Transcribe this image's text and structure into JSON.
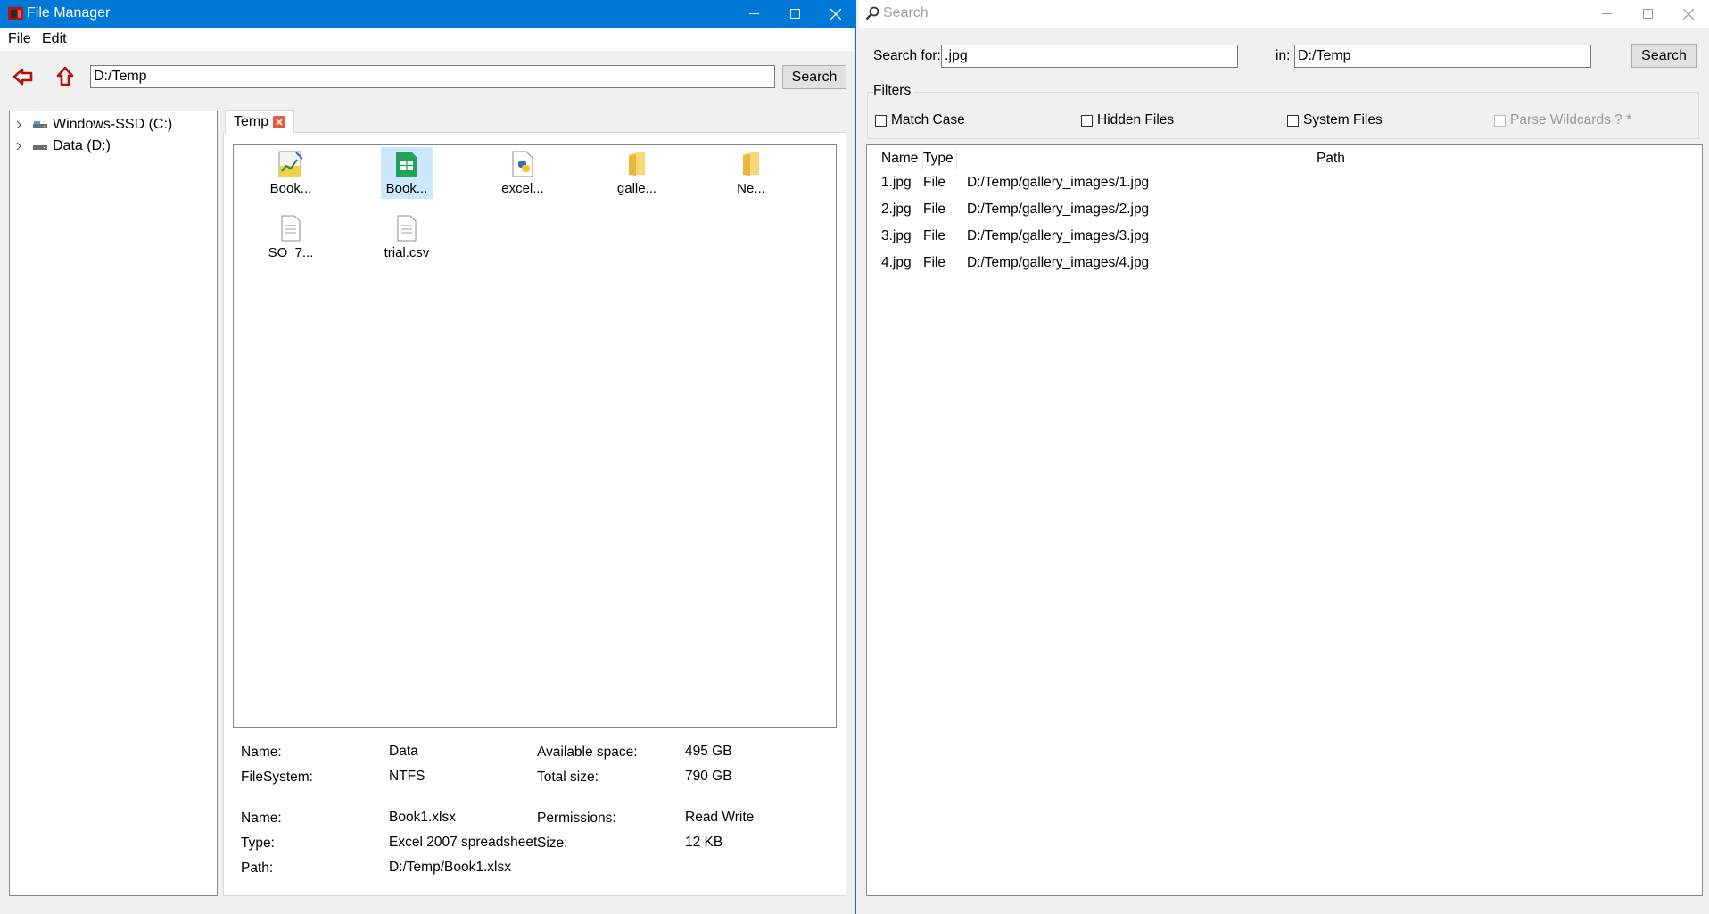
{
  "file_manager": {
    "title": "File Manager",
    "menu": [
      "File",
      "Edit"
    ],
    "path": "D:/Temp",
    "search_label": "Search",
    "tree": [
      {
        "label": "Windows-SSD (C:)",
        "icon": "drive-icon"
      },
      {
        "label": "Data (D:)",
        "icon": "drive-icon"
      }
    ],
    "tab": {
      "label": "Temp"
    },
    "files": [
      {
        "label": "Book...",
        "icon": "spreadsheet-chart-icon",
        "selected": false
      },
      {
        "label": "Book...",
        "icon": "excel-green-icon",
        "selected": true
      },
      {
        "label": "excel...",
        "icon": "python-file-icon",
        "selected": false
      },
      {
        "label": "galle...",
        "icon": "folder-icon",
        "selected": false
      },
      {
        "label": "Ne...",
        "icon": "folder-icon",
        "selected": false
      },
      {
        "label": "SO_7...",
        "icon": "text-file-icon",
        "selected": false
      },
      {
        "label": "trial.csv",
        "icon": "text-file-icon",
        "selected": false
      }
    ],
    "drive_info": {
      "name_label": "Name:",
      "name": "Data",
      "fs_label": "FileSystem:",
      "fs": "NTFS",
      "avail_label": "Available space:",
      "avail": "495 GB",
      "total_label": "Total size:",
      "total": "790 GB"
    },
    "file_info": {
      "name_label": "Name:",
      "name": "Book1.xlsx",
      "type_label": "Type:",
      "type": "Excel 2007 spreadsheet",
      "path_label": "Path:",
      "path": "D:/Temp/Book1.xlsx",
      "perm_label": "Permissions:",
      "perm": "Read Write",
      "size_label": "Size:",
      "size": "12 KB"
    }
  },
  "search_window": {
    "title": "Search",
    "search_for_label": "Search for:",
    "search_for_value": ".jpg",
    "in_label": "in:",
    "in_value": "D:/Temp",
    "search_button": "Search",
    "filters_label": "Filters",
    "filters": [
      {
        "label": "Match Case",
        "checked": false,
        "enabled": true
      },
      {
        "label": "Hidden Files",
        "checked": false,
        "enabled": true
      },
      {
        "label": "System Files",
        "checked": false,
        "enabled": true
      },
      {
        "label": "Parse Wildcards ? *",
        "checked": false,
        "enabled": false
      }
    ],
    "columns": [
      "Name",
      "Type",
      "Path"
    ],
    "results": [
      {
        "name": "1.jpg",
        "type": "File",
        "path": "D:/Temp/gallery_images/1.jpg"
      },
      {
        "name": "2.jpg",
        "type": "File",
        "path": "D:/Temp/gallery_images/2.jpg"
      },
      {
        "name": "3.jpg",
        "type": "File",
        "path": "D:/Temp/gallery_images/3.jpg"
      },
      {
        "name": "4.jpg",
        "type": "File",
        "path": "D:/Temp/gallery_images/4.jpg"
      }
    ]
  },
  "colors": {
    "titlebar_active": "#0078d7",
    "selection": "#cce8ff",
    "nav_arrow": "#b3120e"
  }
}
